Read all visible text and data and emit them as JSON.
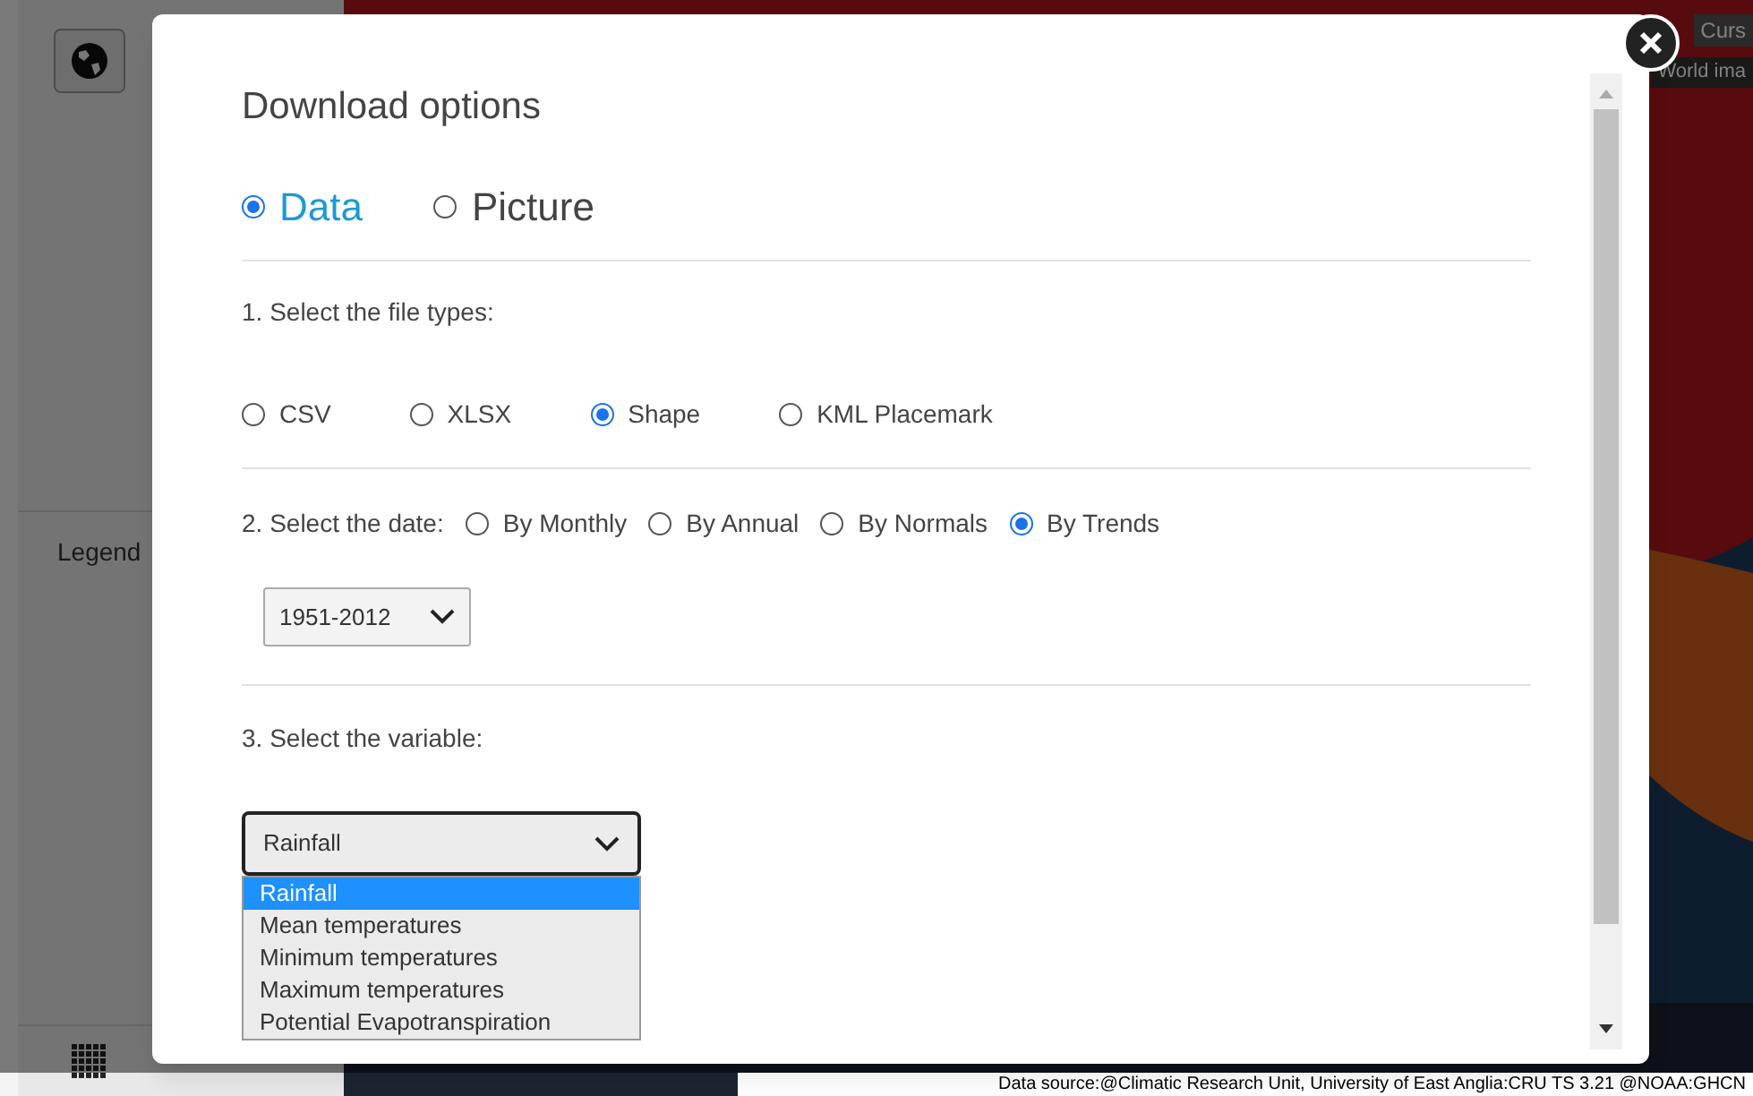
{
  "background": {
    "legend_tab": "Legend",
    "map_button": "Curs",
    "layer_label": "World ima",
    "data_source": "Data source:@Climatic Research Unit, University of East Anglia:CRU TS 3.21  @NOAA:GHCN"
  },
  "dialog": {
    "title": "Download options",
    "modes": [
      {
        "label": "Data",
        "selected": true
      },
      {
        "label": "Picture",
        "selected": false
      }
    ],
    "step1": {
      "label": "1. Select the file types:",
      "options": [
        {
          "label": "CSV",
          "selected": false
        },
        {
          "label": "XLSX",
          "selected": false
        },
        {
          "label": "Shape",
          "selected": true
        },
        {
          "label": "KML Placemark",
          "selected": false
        }
      ]
    },
    "step2": {
      "label": "2. Select the date:",
      "options": [
        {
          "label": "By Monthly",
          "selected": false
        },
        {
          "label": "By Annual",
          "selected": false
        },
        {
          "label": "By Normals",
          "selected": false
        },
        {
          "label": "By Trends",
          "selected": true
        }
      ],
      "period": "1951-2012"
    },
    "step3": {
      "label": "3. Select the variable:",
      "value": "Rainfall",
      "options": [
        {
          "label": "Rainfall",
          "selected": true
        },
        {
          "label": "Mean temperatures",
          "selected": false
        },
        {
          "label": "Minimum temperatures",
          "selected": false
        },
        {
          "label": "Maximum temperatures",
          "selected": false
        },
        {
          "label": "Potential Evapotranspiration",
          "selected": false
        }
      ]
    }
  }
}
